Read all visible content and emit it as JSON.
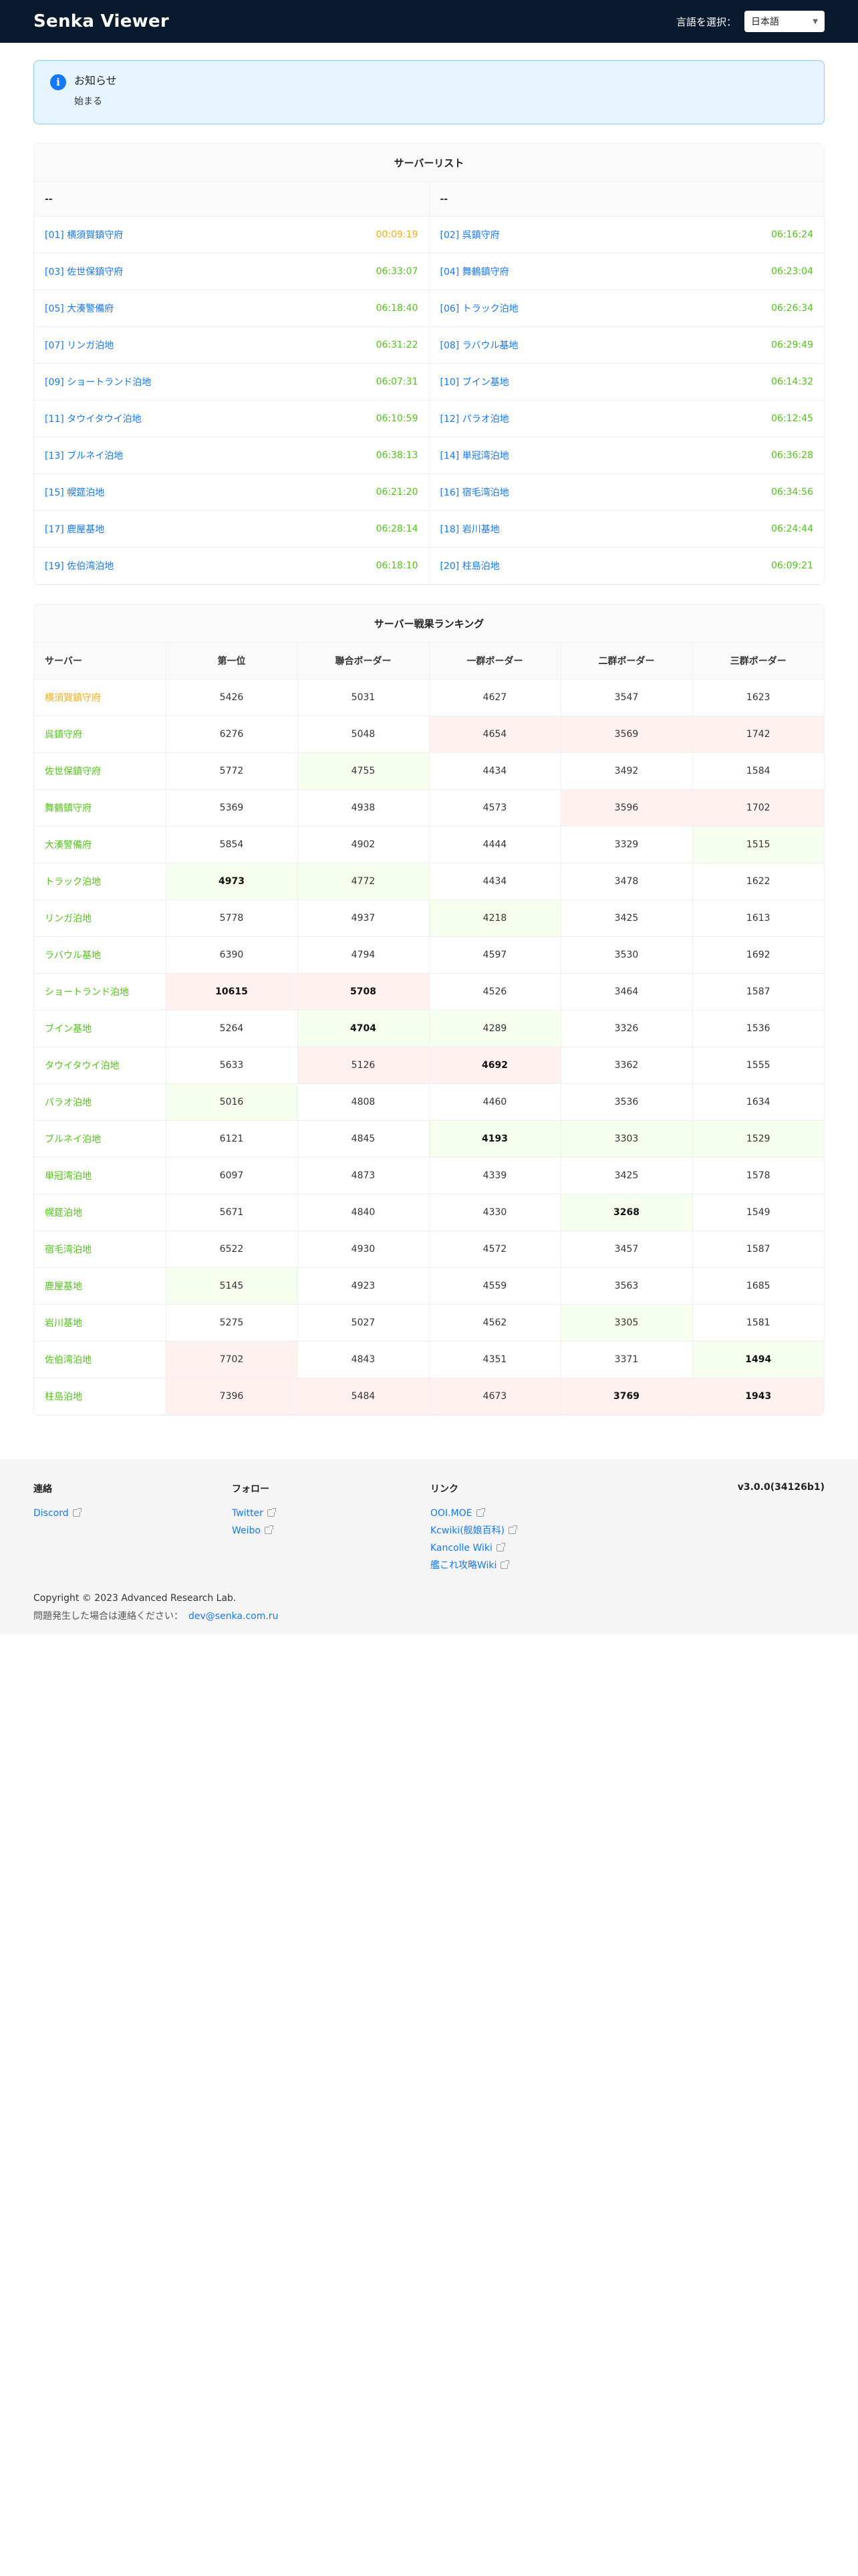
{
  "navbar": {
    "brand": "Senka Viewer",
    "lang_label": "言語を選択：",
    "lang_value": "日本語"
  },
  "notice": {
    "title": "お知らせ",
    "body": "始まる"
  },
  "server_list": {
    "title": "サーバーリスト",
    "col_left": "--",
    "col_right": "--",
    "rows": [
      [
        {
          "name": "[01] 横須賀鎮守府",
          "time": "00:09:19",
          "warn": true
        },
        {
          "name": "[02] 呉鎮守府",
          "time": "06:16:24"
        }
      ],
      [
        {
          "name": "[03] 佐世保鎮守府",
          "time": "06:33:07"
        },
        {
          "name": "[04] 舞鶴鎮守府",
          "time": "06:23:04"
        }
      ],
      [
        {
          "name": "[05] 大湊警備府",
          "time": "06:18:40"
        },
        {
          "name": "[06] トラック泊地",
          "time": "06:26:34"
        }
      ],
      [
        {
          "name": "[07] リンガ泊地",
          "time": "06:31:22"
        },
        {
          "name": "[08] ラバウル基地",
          "time": "06:29:49"
        }
      ],
      [
        {
          "name": "[09] ショートランド泊地",
          "time": "06:07:31"
        },
        {
          "name": "[10] ブイン基地",
          "time": "06:14:32"
        }
      ],
      [
        {
          "name": "[11] タウイタウイ泊地",
          "time": "06:10:59"
        },
        {
          "name": "[12] パラオ泊地",
          "time": "06:12:45"
        }
      ],
      [
        {
          "name": "[13] ブルネイ泊地",
          "time": "06:38:13"
        },
        {
          "name": "[14] 単冠湾泊地",
          "time": "06:36:28"
        }
      ],
      [
        {
          "name": "[15] 幌筵泊地",
          "time": "06:21:20"
        },
        {
          "name": "[16] 宿毛湾泊地",
          "time": "06:34:56"
        }
      ],
      [
        {
          "name": "[17] 鹿屋基地",
          "time": "06:28:14"
        },
        {
          "name": "[18] 岩川基地",
          "time": "06:24:44"
        }
      ],
      [
        {
          "name": "[19] 佐伯湾泊地",
          "time": "06:18:10"
        },
        {
          "name": "[20] 柱島泊地",
          "time": "06:09:21"
        }
      ]
    ]
  },
  "ranking": {
    "title": "サーバー戦果ランキング",
    "headers": [
      "サーバー",
      "第一位",
      "聯合ボーダー",
      "一群ボーダー",
      "二群ボーダー",
      "三群ボーダー"
    ],
    "rows": [
      {
        "name": "横須賀鎮守府",
        "warn": true,
        "vals": [
          "5426",
          "5031",
          "4627",
          "3547",
          "1623"
        ],
        "hi": [],
        "lo": [],
        "b": []
      },
      {
        "name": "呉鎮守府",
        "vals": [
          "6276",
          "5048",
          "4654",
          "3569",
          "1742"
        ],
        "hi": [
          2,
          3,
          4
        ],
        "lo": [],
        "b": []
      },
      {
        "name": "佐世保鎮守府",
        "vals": [
          "5772",
          "4755",
          "4434",
          "3492",
          "1584"
        ],
        "hi": [],
        "lo": [
          1
        ],
        "b": []
      },
      {
        "name": "舞鶴鎮守府",
        "vals": [
          "5369",
          "4938",
          "4573",
          "3596",
          "1702"
        ],
        "hi": [
          3,
          4
        ],
        "lo": [],
        "b": []
      },
      {
        "name": "大湊警備府",
        "vals": [
          "5854",
          "4902",
          "4444",
          "3329",
          "1515"
        ],
        "hi": [],
        "lo": [
          4
        ],
        "b": []
      },
      {
        "name": "トラック泊地",
        "vals": [
          "4973",
          "4772",
          "4434",
          "3478",
          "1622"
        ],
        "hi": [],
        "lo": [
          0,
          1
        ],
        "b": [
          0
        ]
      },
      {
        "name": "リンガ泊地",
        "vals": [
          "5778",
          "4937",
          "4218",
          "3425",
          "1613"
        ],
        "hi": [],
        "lo": [
          2
        ],
        "b": []
      },
      {
        "name": "ラバウル基地",
        "vals": [
          "6390",
          "4794",
          "4597",
          "3530",
          "1692"
        ],
        "hi": [],
        "lo": [],
        "b": []
      },
      {
        "name": "ショートランド泊地",
        "vals": [
          "10615",
          "5708",
          "4526",
          "3464",
          "1587"
        ],
        "hi": [
          0,
          1
        ],
        "lo": [],
        "b": [
          0,
          1
        ]
      },
      {
        "name": "ブイン基地",
        "vals": [
          "5264",
          "4704",
          "4289",
          "3326",
          "1536"
        ],
        "hi": [],
        "lo": [
          1,
          2
        ],
        "b": [
          1
        ]
      },
      {
        "name": "タウイタウイ泊地",
        "vals": [
          "5633",
          "5126",
          "4692",
          "3362",
          "1555"
        ],
        "hi": [
          1,
          2
        ],
        "lo": [],
        "b": [
          2
        ]
      },
      {
        "name": "パラオ泊地",
        "vals": [
          "5016",
          "4808",
          "4460",
          "3536",
          "1634"
        ],
        "hi": [],
        "lo": [
          0
        ],
        "b": []
      },
      {
        "name": "ブルネイ泊地",
        "vals": [
          "6121",
          "4845",
          "4193",
          "3303",
          "1529"
        ],
        "hi": [],
        "lo": [
          2,
          3,
          4
        ],
        "b": [
          2
        ]
      },
      {
        "name": "単冠湾泊地",
        "vals": [
          "6097",
          "4873",
          "4339",
          "3425",
          "1578"
        ],
        "hi": [],
        "lo": [],
        "b": []
      },
      {
        "name": "幌筵泊地",
        "vals": [
          "5671",
          "4840",
          "4330",
          "3268",
          "1549"
        ],
        "hi": [],
        "lo": [
          3
        ],
        "b": [
          3
        ]
      },
      {
        "name": "宿毛湾泊地",
        "vals": [
          "6522",
          "4930",
          "4572",
          "3457",
          "1587"
        ],
        "hi": [],
        "lo": [],
        "b": []
      },
      {
        "name": "鹿屋基地",
        "vals": [
          "5145",
          "4923",
          "4559",
          "3563",
          "1685"
        ],
        "hi": [],
        "lo": [
          0
        ],
        "b": []
      },
      {
        "name": "岩川基地",
        "vals": [
          "5275",
          "5027",
          "4562",
          "3305",
          "1581"
        ],
        "hi": [],
        "lo": [
          3
        ],
        "b": []
      },
      {
        "name": "佐伯湾泊地",
        "vals": [
          "7702",
          "4843",
          "4351",
          "3371",
          "1494"
        ],
        "hi": [
          0
        ],
        "lo": [
          4
        ],
        "b": [
          4
        ]
      },
      {
        "name": "柱島泊地",
        "vals": [
          "7396",
          "5484",
          "4673",
          "3769",
          "1943"
        ],
        "hi": [
          0,
          1,
          2,
          3,
          4
        ],
        "lo": [],
        "b": [
          3,
          4
        ]
      }
    ]
  },
  "footer": {
    "contact_title": "連絡",
    "contact_links": [
      "Discord"
    ],
    "follow_title": "フォロー",
    "follow_links": [
      "Twitter",
      "Weibo"
    ],
    "links_title": "リンク",
    "links": [
      "OOI.MOE",
      "Kcwiki(舰娘百科)",
      "Kancolle Wiki",
      "艦これ攻略Wiki"
    ],
    "version": "v3.0.0(34126b1)",
    "copyright": "Copyright © 2023 Advanced Research Lab.",
    "contact_text": "問題発生した場合は連絡ください：",
    "email": "dev@senka.com.ru"
  },
  "colors": {
    "nav_bg": "#0a1a2e",
    "link": "#1677ff",
    "ok": "#52c41a",
    "warn": "#faad14",
    "high_cell": "#fff1f0",
    "low_cell": "#f6ffed"
  }
}
